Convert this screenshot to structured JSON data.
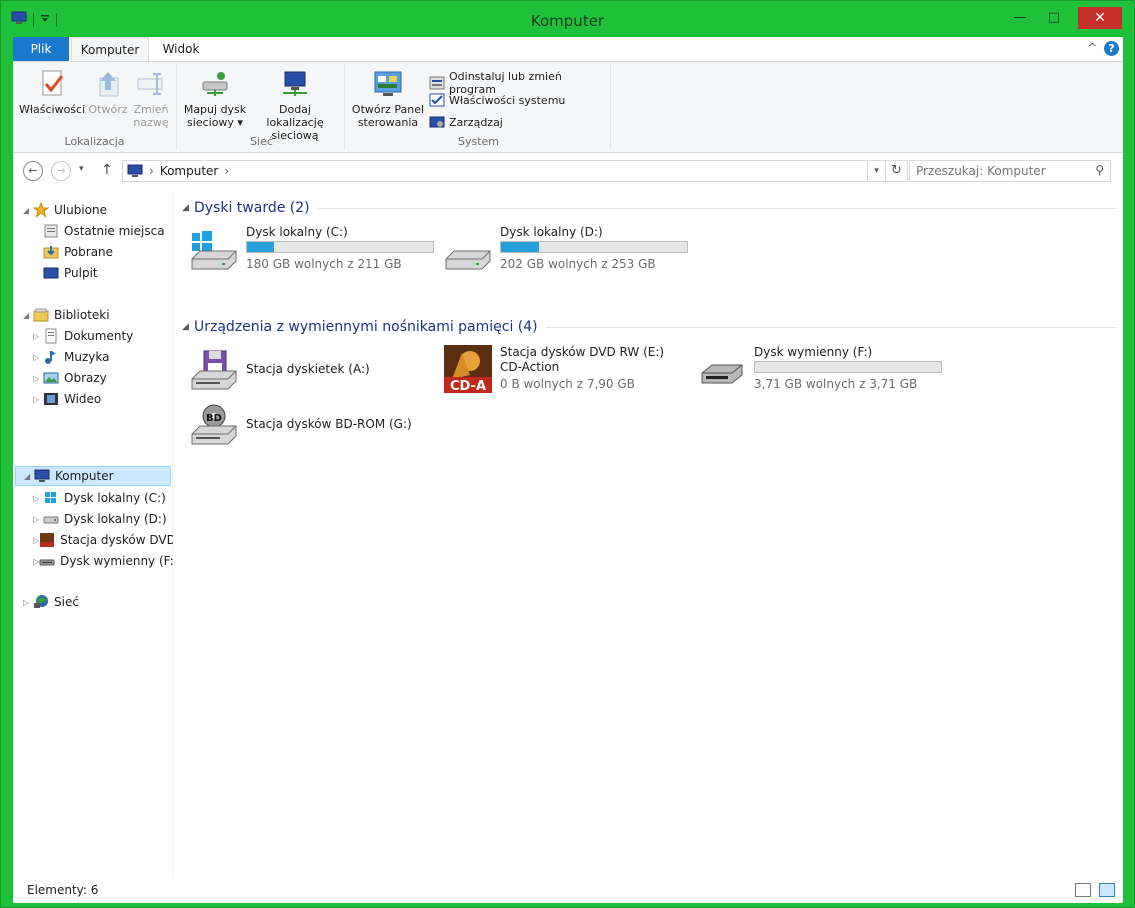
{
  "window": {
    "title": "Komputer",
    "minimize_glyph": "—",
    "maximize_glyph": "□",
    "close_glyph": "✕"
  },
  "ribbon": {
    "tabs": [
      {
        "label": "Plik"
      },
      {
        "label": "Komputer"
      },
      {
        "label": "Widok"
      }
    ],
    "help_glyph": "?",
    "collapse_glyph": "^",
    "groups": {
      "location": {
        "label": "Lokalizacja",
        "properties": "Właściwości",
        "open": "Otwórz",
        "rename_1": "Zmień",
        "rename_2": "nazwę"
      },
      "network": {
        "label": "Sieć",
        "map_drive_1": "Mapuj dysk",
        "map_drive_2": "sieciowy ▾",
        "add_location_1": "Dodaj lokalizację",
        "add_location_2": "sieciową"
      },
      "system": {
        "label": "System",
        "control_panel_1": "Otwórz Panel",
        "control_panel_2": "sterowania",
        "uninstall": "Odinstaluj lub zmień program",
        "sys_props": "Właściwości systemu",
        "manage": "Zarządzaj"
      }
    }
  },
  "navbar": {
    "back": "←",
    "forward": "→",
    "recent": "▾",
    "up": "↑",
    "crumb_sep": "›",
    "crumb": "Komputer",
    "crumb_tail": "›",
    "dropdown": "▾",
    "refresh": "↻",
    "search_placeholder": "Przeszukaj: Komputer",
    "search_glyph": "⚲"
  },
  "navpane": {
    "favorites": "Ulubione",
    "recent": "Ostatnie miejsca",
    "downloads": "Pobrane",
    "desktop": "Pulpit",
    "libraries": "Biblioteki",
    "documents": "Dokumenty",
    "music": "Muzyka",
    "pictures": "Obrazy",
    "video": "Wideo",
    "computer": "Komputer",
    "drive_c": "Dysk lokalny (C:)",
    "drive_d": "Dysk lokalny (D:)",
    "drive_e": "Stacja dysków DVD RW (E:)",
    "drive_f": "Dysk wymienny (F:)",
    "network": "Sieć"
  },
  "content": {
    "hard_drives_title": "Dyski twarde (2)",
    "removable_title": "Urządzenia z wymiennymi nośnikami pamięci (4)",
    "drives": {
      "c": {
        "name": "Dysk lokalny (C:)",
        "free": "180 GB wolnych z 211 GB",
        "used_fraction": 0.147
      },
      "d": {
        "name": "Dysk lokalny (D:)",
        "free": "202 GB wolnych z 253 GB",
        "used_fraction": 0.202
      },
      "a": {
        "name": "Stacja dyskietek (A:)"
      },
      "e": {
        "name": "Stacja dysków DVD RW (E:)",
        "label": "CD-Action",
        "free": "0 B wolnych z 7,90 GB",
        "logo": "CD-A"
      },
      "f": {
        "name": "Dysk wymienny (F:)",
        "free": "3,71 GB wolnych z 3,71 GB",
        "used_fraction": 0.0
      },
      "g": {
        "name": "Stacja dysków BD-ROM (G:)",
        "logo": "BD"
      }
    }
  },
  "status": {
    "count": "Elementy: 6"
  },
  "colors": {
    "window_frame": "#1fc13a",
    "accent": "#1979ca",
    "bar_fill": "#26a0da",
    "section_title": "#1e3287"
  }
}
